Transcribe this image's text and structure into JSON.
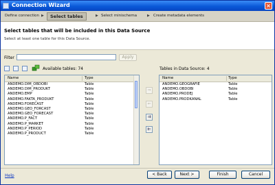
{
  "window": {
    "title": "Connection Wizard",
    "close_symbol": "×"
  },
  "steps": {
    "items": [
      "Define connection",
      "Select tables",
      "Select minischema",
      "Create metadata elements"
    ],
    "arrow": "▶"
  },
  "content": {
    "heading": "Select tables that will be included in this Data Source",
    "subheading": "Select at least one table for this Data Source."
  },
  "filter": {
    "label": "Filter",
    "value": "",
    "apply_label": "Apply"
  },
  "available": {
    "label": "Available tables: 74",
    "columns": [
      "Name",
      "Type"
    ],
    "rows": [
      {
        "name": "ANDEMO.DIM_OBDOBI",
        "type": "Table"
      },
      {
        "name": "ANDEMO.DIM_PRODUKT",
        "type": "Table"
      },
      {
        "name": "ANDEMO.EMP",
        "type": "Table"
      },
      {
        "name": "ANDEMO.FAKTA_PRODUKT",
        "type": "Table"
      },
      {
        "name": "ANDEMO.FORECAST",
        "type": "Table"
      },
      {
        "name": "ANDEMO.GEO_FORCAST",
        "type": "Table"
      },
      {
        "name": "ANDEMO.GEO_FORECAST",
        "type": "Table"
      },
      {
        "name": "ANDEMO.P_FACT",
        "type": "Table"
      },
      {
        "name": "ANDEMO.P_MARKET",
        "type": "Table"
      },
      {
        "name": "ANDEMO.P_PERIOD",
        "type": "Table"
      },
      {
        "name": "ANDEMO.P_PRODUCT",
        "type": "Table"
      }
    ]
  },
  "selected": {
    "label": "Tables in Data Source: 4",
    "columns": [
      "Name",
      "Type"
    ],
    "rows": [
      {
        "name": "ANDEMO.GEOGRAFIE",
        "type": "Table"
      },
      {
        "name": "ANDEMO.OBDOBI",
        "type": "Table"
      },
      {
        "name": "ANDEMO.PRODEJ",
        "type": "Table"
      },
      {
        "name": "ANDEMO.PRODKANAL",
        "type": "Table"
      }
    ]
  },
  "transfer_buttons": {
    "add": "⇒",
    "remove": "⇐",
    "add_all": "⇉",
    "remove_all": "⇇"
  },
  "footer": {
    "help": "Help",
    "back": "< Back",
    "next": "Next >",
    "finish": "Finish",
    "cancel": "Cancel"
  },
  "colors": {
    "titlebar": "#0a58d8",
    "link": "#0a35c2",
    "accent_green": "#3a9a2a"
  }
}
